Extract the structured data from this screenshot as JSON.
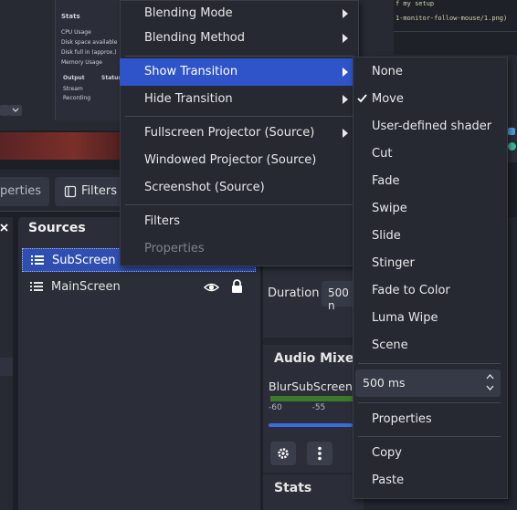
{
  "background": {
    "stats_panel": {
      "title": "Stats",
      "rows": [
        "CPU Usage",
        "Disk space available",
        "Disk full in (approx.)",
        "Memory Usage"
      ],
      "table_headers": [
        "Output",
        "Status"
      ],
      "table_rows": [
        "Stream",
        "Recording"
      ]
    },
    "code_lines": [
      "f my setup",
      "1-monitor-follow-mouse/1.png)"
    ],
    "properties_tab_label": "perties",
    "filters_tab_label": "Filters",
    "sources": {
      "title": "Sources",
      "items": [
        {
          "label": "SubScreen",
          "selected": true
        },
        {
          "label": "MainScreen",
          "selected": false
        }
      ]
    },
    "duration": {
      "label": "Duration",
      "value": "500 n"
    },
    "audio_mixer": {
      "title": "Audio Mixer",
      "source_label": "BlurSubScreen",
      "tick_labels": [
        "-60",
        "-55"
      ]
    },
    "stats_title": "Stats"
  },
  "context_menu": {
    "items": [
      {
        "label": "Blending Mode",
        "has_submenu": true
      },
      {
        "label": "Blending Method",
        "has_submenu": true
      },
      {
        "label": "Show Transition",
        "has_submenu": true,
        "active": true
      },
      {
        "label": "Hide Transition",
        "has_submenu": true
      },
      {
        "label": "Fullscreen Projector (Source)",
        "has_submenu": true
      },
      {
        "label": "Windowed Projector (Source)"
      },
      {
        "label": "Screenshot (Source)"
      },
      {
        "label": "Filters"
      },
      {
        "label": "Properties",
        "disabled": true
      }
    ]
  },
  "transition_submenu": {
    "options": [
      "None",
      "Move",
      "User-defined shader",
      "Cut",
      "Fade",
      "Swipe",
      "Slide",
      "Stinger",
      "Fade to Color",
      "Luma Wipe",
      "Scene"
    ],
    "checked": "Move",
    "duration_value": "500 ms",
    "extra_items": [
      "Properties",
      "Copy",
      "Paste"
    ]
  },
  "colors": {
    "accent": "#2f54c9",
    "menu_bg": "#262932",
    "selection": "#2f4fb0"
  }
}
